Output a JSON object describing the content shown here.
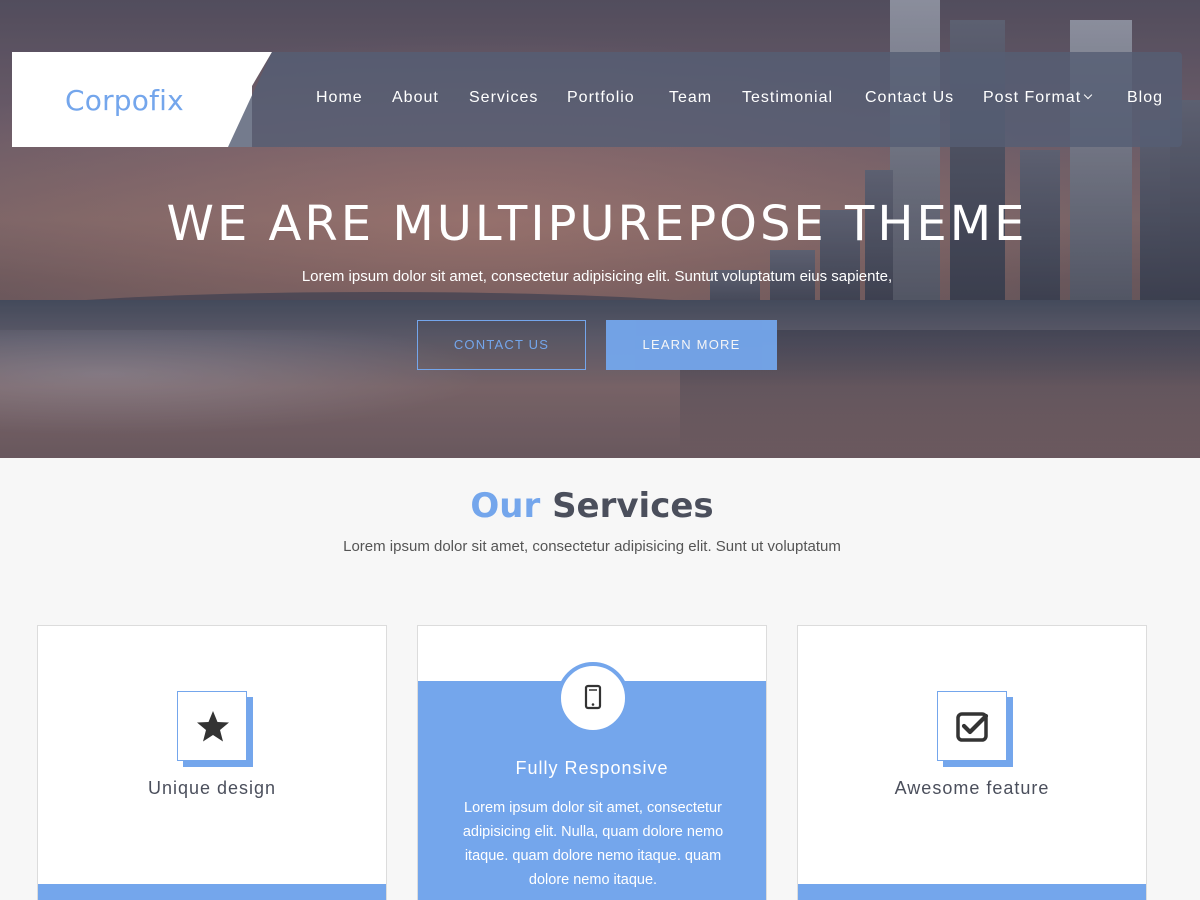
{
  "brand": {
    "name": "Corpofix",
    "accent_color": "#74a6ec"
  },
  "nav": {
    "items": [
      {
        "label": "Home"
      },
      {
        "label": "About"
      },
      {
        "label": "Services"
      },
      {
        "label": "Portfolio"
      },
      {
        "label": "Team"
      },
      {
        "label": "Testimonial"
      },
      {
        "label": "Contact Us"
      },
      {
        "label": "Post Format",
        "has_dropdown": true,
        "icon": "chevron-down-icon"
      },
      {
        "label": "Blog"
      }
    ]
  },
  "hero": {
    "title": "WE ARE MULTIPUREPOSE THEME",
    "subtitle": "Lorem ipsum dolor sit amet, consectetur adipisicing elit. Suntut voluptatum eius sapiente,",
    "contact_button": "CONTACT US",
    "learn_button": "LEARN MORE"
  },
  "services": {
    "title_accent": "Our",
    "title_rest": " Services",
    "subtitle": "Lorem ipsum dolor sit amet, consectetur adipisicing elit. Sunt ut voluptatum",
    "cards": [
      {
        "label": "Unique design",
        "icon": "star-icon"
      },
      {
        "label": "Fully Responsive",
        "icon": "mobile-icon",
        "description": "Lorem ipsum dolor sit amet, consectetur adipisicing elit. Nulla, quam dolore nemo itaque. quam dolore nemo itaque. quam dolore nemo itaque."
      },
      {
        "label": "Awesome feature",
        "icon": "check-square-icon"
      }
    ]
  }
}
